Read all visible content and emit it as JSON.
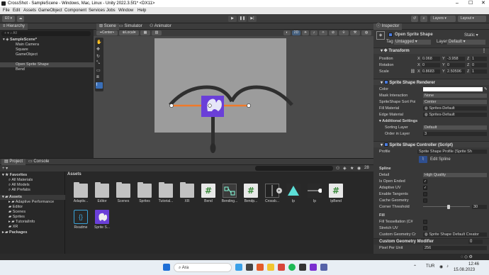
{
  "window": {
    "title": "CrossShot - SampleScene - Windows, Mac, Linux - Unity 2022.3.5f1* <DX11>"
  },
  "menu": [
    "File",
    "Edit",
    "Assets",
    "GameObject",
    "Component",
    "Services",
    "Jobs",
    "Window",
    "Help"
  ],
  "toolbar": {
    "account": "E0",
    "layers": "Layers",
    "layout": "Layout"
  },
  "hierarchy": {
    "tab": "Hierarchy",
    "search_placeholder": "All",
    "items": [
      {
        "label": "SampleScene*"
      },
      {
        "label": "Main Camera"
      },
      {
        "label": "Square"
      },
      {
        "label": "GameObject"
      },
      {
        "label": "Open Sprite Shape"
      },
      {
        "label": "Bend"
      }
    ]
  },
  "scene": {
    "tabs": [
      "Scene",
      "Simulator",
      "Animator"
    ],
    "pivot": "Center",
    "space": "Local",
    "mode_2d": "2D"
  },
  "project": {
    "tabs": [
      "Project",
      "Console"
    ],
    "count": "28",
    "favorites_label": "Favorites",
    "favorites": [
      "All Materials",
      "All Models",
      "All Prefabs"
    ],
    "assets_label": "Assets",
    "asset_tree": [
      "Adaptive Performance",
      "Editor",
      "Scenes",
      "Sprites",
      "TutorialInfo",
      "XR"
    ],
    "packages_label": "Packages",
    "breadcrumb": "Assets",
    "grid_row1": [
      "Adaptiv...",
      "Editor",
      "Scenes",
      "Sprites",
      "Tutorial...",
      "XR",
      "Bend",
      "Bending...",
      "Bendp...",
      "Crossb...",
      "Ip",
      "Ip",
      "IpBend"
    ],
    "grid_row2": [
      "Readme",
      "Sprite S..."
    ]
  },
  "inspector": {
    "tab": "Inspector",
    "object_name": "Open Sprite Shape",
    "static_label": "Static",
    "tag_label": "Tag",
    "tag_value": "Untagged",
    "layer_label": "Layer",
    "layer_value": "Default",
    "transform": {
      "title": "Transform",
      "position": {
        "label": "Position",
        "x": "0.068",
        "y": "-3.958",
        "z": "1"
      },
      "rotation": {
        "label": "Rotation",
        "x": "0",
        "y": "0",
        "z": "0"
      },
      "scale": {
        "label": "Scale",
        "x": "0.8683",
        "y": "2.50596",
        "z": "1"
      }
    },
    "renderer": {
      "title": "Sprite Shape Renderer",
      "color_label": "Color",
      "mask_label": "Mask Interaction",
      "mask_value": "None",
      "sort_label": "SpriteShape Sort Poi",
      "sort_value": "Center",
      "fill_label": "Fill Material",
      "fill_value": "Sprites-Default",
      "edge_label": "Edge Material",
      "edge_value": "Sprites-Default",
      "additional_label": "Additional Settings",
      "sorting_layer_label": "Sorting Layer",
      "sorting_layer_value": "Default",
      "order_label": "Order in Layer",
      "order_value": "3"
    },
    "controller": {
      "title": "Sprite Shape Controller (Script)",
      "profile_label": "Profile",
      "profile_value": "Sprite Shape Profile (Sprite Sh",
      "edit_spline": "Edit Spline",
      "spline_label": "Spline",
      "detail_label": "Detail",
      "detail_value": "High Quality",
      "open_ended_label": "Is Open Ended",
      "adaptive_uv_label": "Adaptive UV",
      "tangents_label": "Enable Tangents",
      "cache_label": "Cache Geometry",
      "corner_label": "Corner Threshold",
      "corner_value": "30",
      "corner_fraction": 0.55,
      "fill_section": "Fill",
      "tessellation_label": "Fill Tessellation (C#",
      "stretch_label": "Stretch UV",
      "custom_geo_label": "Custom Geometry Cr",
      "custom_geo_value": "Sprite Shape Default Creator",
      "custom_mod_label": "Custom Geometry Modifier",
      "custom_mod_count": "0",
      "ppu_label": "Pixel Per Unit",
      "ppu_value": "256"
    }
  },
  "taskbar": {
    "search": "Ara",
    "lang": "TUR",
    "time": "12:46",
    "date": "15.08.2023"
  },
  "colors": {
    "accent": "#3a7bd5",
    "selection": "#474747",
    "sprite": "#6a3fd8",
    "edge": "#f07a2a"
  }
}
